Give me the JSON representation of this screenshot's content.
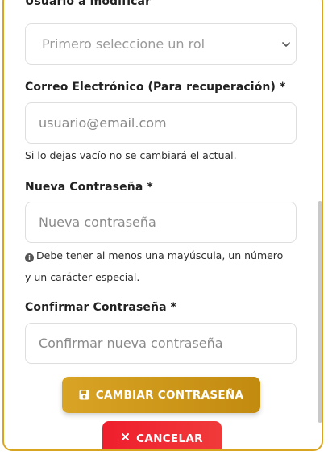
{
  "form": {
    "cut_label": "Usuario a modificar",
    "user_select": {
      "selected": "Primero seleccione un rol"
    },
    "email": {
      "label": "Correo Electrónico (Para recuperación) *",
      "placeholder": "usuario@email.com",
      "hint": "Si lo dejas vacío no se cambiará el actual."
    },
    "new_password": {
      "label": "Nueva Contraseña *",
      "placeholder": "Nueva contraseña",
      "hint_line1": "Debe tener al menos una mayúscula, un número",
      "hint_line2": "y un carácter especial."
    },
    "confirm_password": {
      "label": "Confirmar Contraseña *",
      "placeholder": "Confirmar nueva contraseña"
    }
  },
  "buttons": {
    "change_password": "CAMBIAR CONTRASEÑA",
    "cancel": "CANCELAR"
  },
  "colors": {
    "accent": "#d9a521",
    "primary_button": "#c9951a",
    "danger_button": "#ef2330"
  },
  "icons": {
    "save": "save-icon",
    "info": "info-icon",
    "cancel": "close-icon",
    "select": "chevron-down-icon"
  }
}
